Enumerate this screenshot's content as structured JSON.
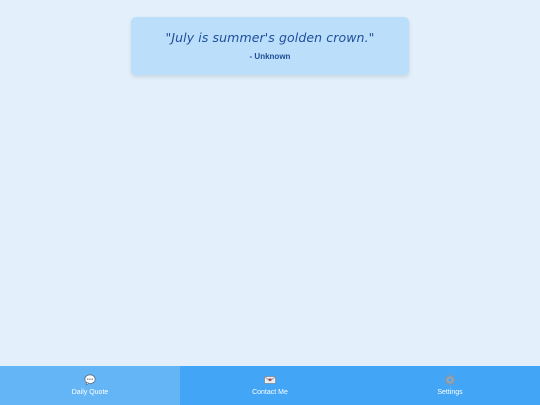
{
  "quote": {
    "text": "\"July is summer's golden crown.\"",
    "author": "- Unknown"
  },
  "tabbar": {
    "active_tab": "daily-quote",
    "tabs": [
      {
        "id": "daily-quote",
        "label": "Daily Quote",
        "icon": "speech-bubble-icon"
      },
      {
        "id": "contact-me",
        "label": "Contact Me",
        "icon": "email-icon"
      },
      {
        "id": "settings",
        "label": "Settings",
        "icon": "gear-icon"
      }
    ]
  },
  "colors": {
    "background": "#e3f0fc",
    "card": "#bbdefb",
    "quote_text": "#1f4f9a",
    "tabbar": "#42a5f5",
    "tab_active": "#64b5f6"
  }
}
